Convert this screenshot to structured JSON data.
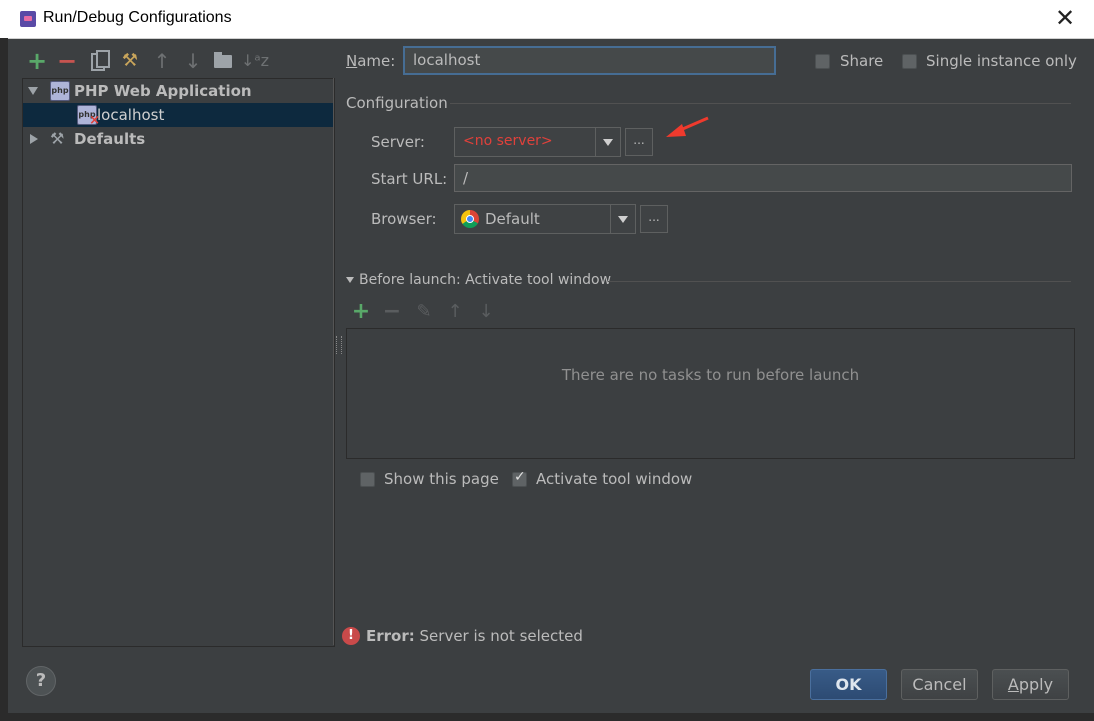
{
  "window": {
    "title": "Run/Debug Configurations",
    "close_glyph": "✕"
  },
  "toolbar": {
    "add": "+",
    "remove": "−",
    "wrench": "⚒",
    "up": "↑",
    "down": "↓",
    "sort": "↓ᵃz"
  },
  "tree": {
    "items": [
      {
        "label": "PHP Web Application",
        "icon": "php-icon",
        "expanded": true
      },
      {
        "label": "localhost",
        "icon": "php-error-icon",
        "selected": true
      },
      {
        "label": "Defaults",
        "icon": "defaults-icon",
        "expanded": false
      }
    ]
  },
  "form": {
    "name_label": "Name:",
    "name_value": "localhost",
    "share_label": "Share",
    "single_instance_label": "Single instance only",
    "configuration_label": "Configuration",
    "server_label": "Server:",
    "server_value": "<no server>",
    "server_dots": "...",
    "start_url_label": "Start URL:",
    "start_url_value": "/",
    "browser_label": "Browser:",
    "browser_value": "Default",
    "browser_dots": "..."
  },
  "before_launch": {
    "label": "Before launch: Activate tool window",
    "empty_text": "There are no tasks to run before launch",
    "show_page_label": "Show this page",
    "activate_label": "Activate tool window",
    "activate_checked": true,
    "show_page_checked": false
  },
  "status": {
    "error_label": "Error:",
    "error_text": "Server is not selected"
  },
  "buttons": {
    "ok": "OK",
    "cancel": "Cancel",
    "apply": "Apply",
    "help": "?"
  },
  "colors": {
    "error_red": "#e0413b",
    "accent_blue": "#466d94",
    "selection": "#0d293e"
  }
}
